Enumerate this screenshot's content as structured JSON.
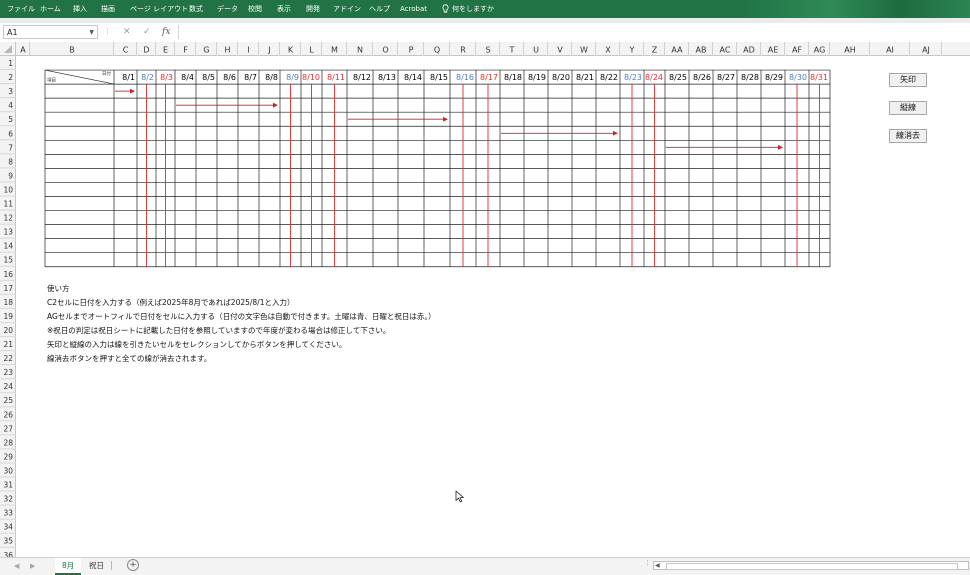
{
  "ribbon": {
    "tabs": [
      "ファイル",
      "ホーム",
      "挿入",
      "描画",
      "ページ レイアウト",
      "数式",
      "データ",
      "校閲",
      "表示",
      "開発",
      "アドイン",
      "ヘルプ",
      "Acrobat"
    ],
    "search_placeholder": "何をしますか",
    "color": "#217346"
  },
  "formula_bar": {
    "name_box": "A1",
    "cancel_icon": "✕",
    "enter_icon": "✓",
    "fx_label": "fx",
    "value": ""
  },
  "columns": [
    "A",
    "B",
    "C",
    "D",
    "E",
    "F",
    "G",
    "H",
    "I",
    "J",
    "K",
    "L",
    "M",
    "N",
    "O",
    "P",
    "Q",
    "R",
    "S",
    "T",
    "U",
    "V",
    "W",
    "X",
    "Y",
    "Z",
    "AA",
    "AB",
    "AC",
    "AD",
    "AE",
    "AF",
    "AG",
    "AH",
    "AI",
    "AJ"
  ],
  "rows": [
    "1",
    "2",
    "3",
    "4",
    "5",
    "6",
    "7",
    "8",
    "9",
    "10",
    "11",
    "12",
    "13",
    "14",
    "15",
    "16",
    "17",
    "18",
    "19",
    "20",
    "21",
    "22",
    "23",
    "24",
    "25",
    "26",
    "27",
    "28",
    "29",
    "30",
    "31",
    "32",
    "33",
    "34",
    "35",
    "36"
  ],
  "corner_header": {
    "top": "日付",
    "bottom": "項目"
  },
  "dates": [
    {
      "label": "8/1",
      "kind": "weekday"
    },
    {
      "label": "8/2",
      "kind": "saturday"
    },
    {
      "label": "8/3",
      "kind": "sunday"
    },
    {
      "label": "8/4",
      "kind": "weekday"
    },
    {
      "label": "8/5",
      "kind": "weekday"
    },
    {
      "label": "8/6",
      "kind": "weekday"
    },
    {
      "label": "8/7",
      "kind": "weekday"
    },
    {
      "label": "8/8",
      "kind": "weekday"
    },
    {
      "label": "8/9",
      "kind": "saturday"
    },
    {
      "label": "8/10",
      "kind": "sunday"
    },
    {
      "label": "8/11",
      "kind": "holiday"
    },
    {
      "label": "8/12",
      "kind": "weekday"
    },
    {
      "label": "8/13",
      "kind": "weekday"
    },
    {
      "label": "8/14",
      "kind": "weekday"
    },
    {
      "label": "8/15",
      "kind": "weekday"
    },
    {
      "label": "8/16",
      "kind": "saturday"
    },
    {
      "label": "8/17",
      "kind": "sunday"
    },
    {
      "label": "8/18",
      "kind": "weekday"
    },
    {
      "label": "8/19",
      "kind": "weekday"
    },
    {
      "label": "8/20",
      "kind": "weekday"
    },
    {
      "label": "8/21",
      "kind": "weekday"
    },
    {
      "label": "8/22",
      "kind": "weekday"
    },
    {
      "label": "8/23",
      "kind": "saturday"
    },
    {
      "label": "8/24",
      "kind": "sunday"
    },
    {
      "label": "8/25",
      "kind": "weekday"
    },
    {
      "label": "8/26",
      "kind": "weekday"
    },
    {
      "label": "8/27",
      "kind": "weekday"
    },
    {
      "label": "8/28",
      "kind": "weekday"
    },
    {
      "label": "8/29",
      "kind": "weekday"
    },
    {
      "label": "8/30",
      "kind": "saturday"
    },
    {
      "label": "8/31",
      "kind": "sunday"
    }
  ],
  "date_colors": {
    "weekday": "#000000",
    "saturday": "#4a7ebb",
    "sunday": "#e03030",
    "holiday": "#e03030"
  },
  "red_vline_dates": [
    "8/2",
    "8/3",
    "8/9",
    "8/10",
    "8/11",
    "8/16",
    "8/17",
    "8/23",
    "8/24",
    "8/30",
    "8/31"
  ],
  "arrows": [
    {
      "row": 3,
      "from": "8/1",
      "to": "8/1"
    },
    {
      "row": 4,
      "from": "8/4",
      "to": "8/8"
    },
    {
      "row": 5,
      "from": "8/12",
      "to": "8/15"
    },
    {
      "row": 6,
      "from": "8/18",
      "to": "8/22"
    },
    {
      "row": 7,
      "from": "8/25",
      "to": "8/29"
    }
  ],
  "arrow_color": "#d42020",
  "instructions": {
    "title": "使い方",
    "lines": [
      "C2セルに日付を入力する（例えば2025年8月であれば2025/8/1と入力）",
      "AGセルまでオートフィルで日付をセルに入力する（日付の文字色は自動で付きます。土曜は青、日曜と祝日は赤。）",
      "※祝日の判定は祝日シートに記載した日付を参照していますので年度が変わる場合は修正して下さい。",
      "矢印と縦線の入力は線を引きたいセルをセレクションしてからボタンを押してください。",
      "線消去ボタンを押すと全ての線が消去されます。"
    ]
  },
  "buttons": {
    "arrow": "矢印",
    "vline": "縦線",
    "erase": "線消去"
  },
  "sheet_tabs": [
    "8月",
    "祝日"
  ],
  "active_sheet": "8月"
}
